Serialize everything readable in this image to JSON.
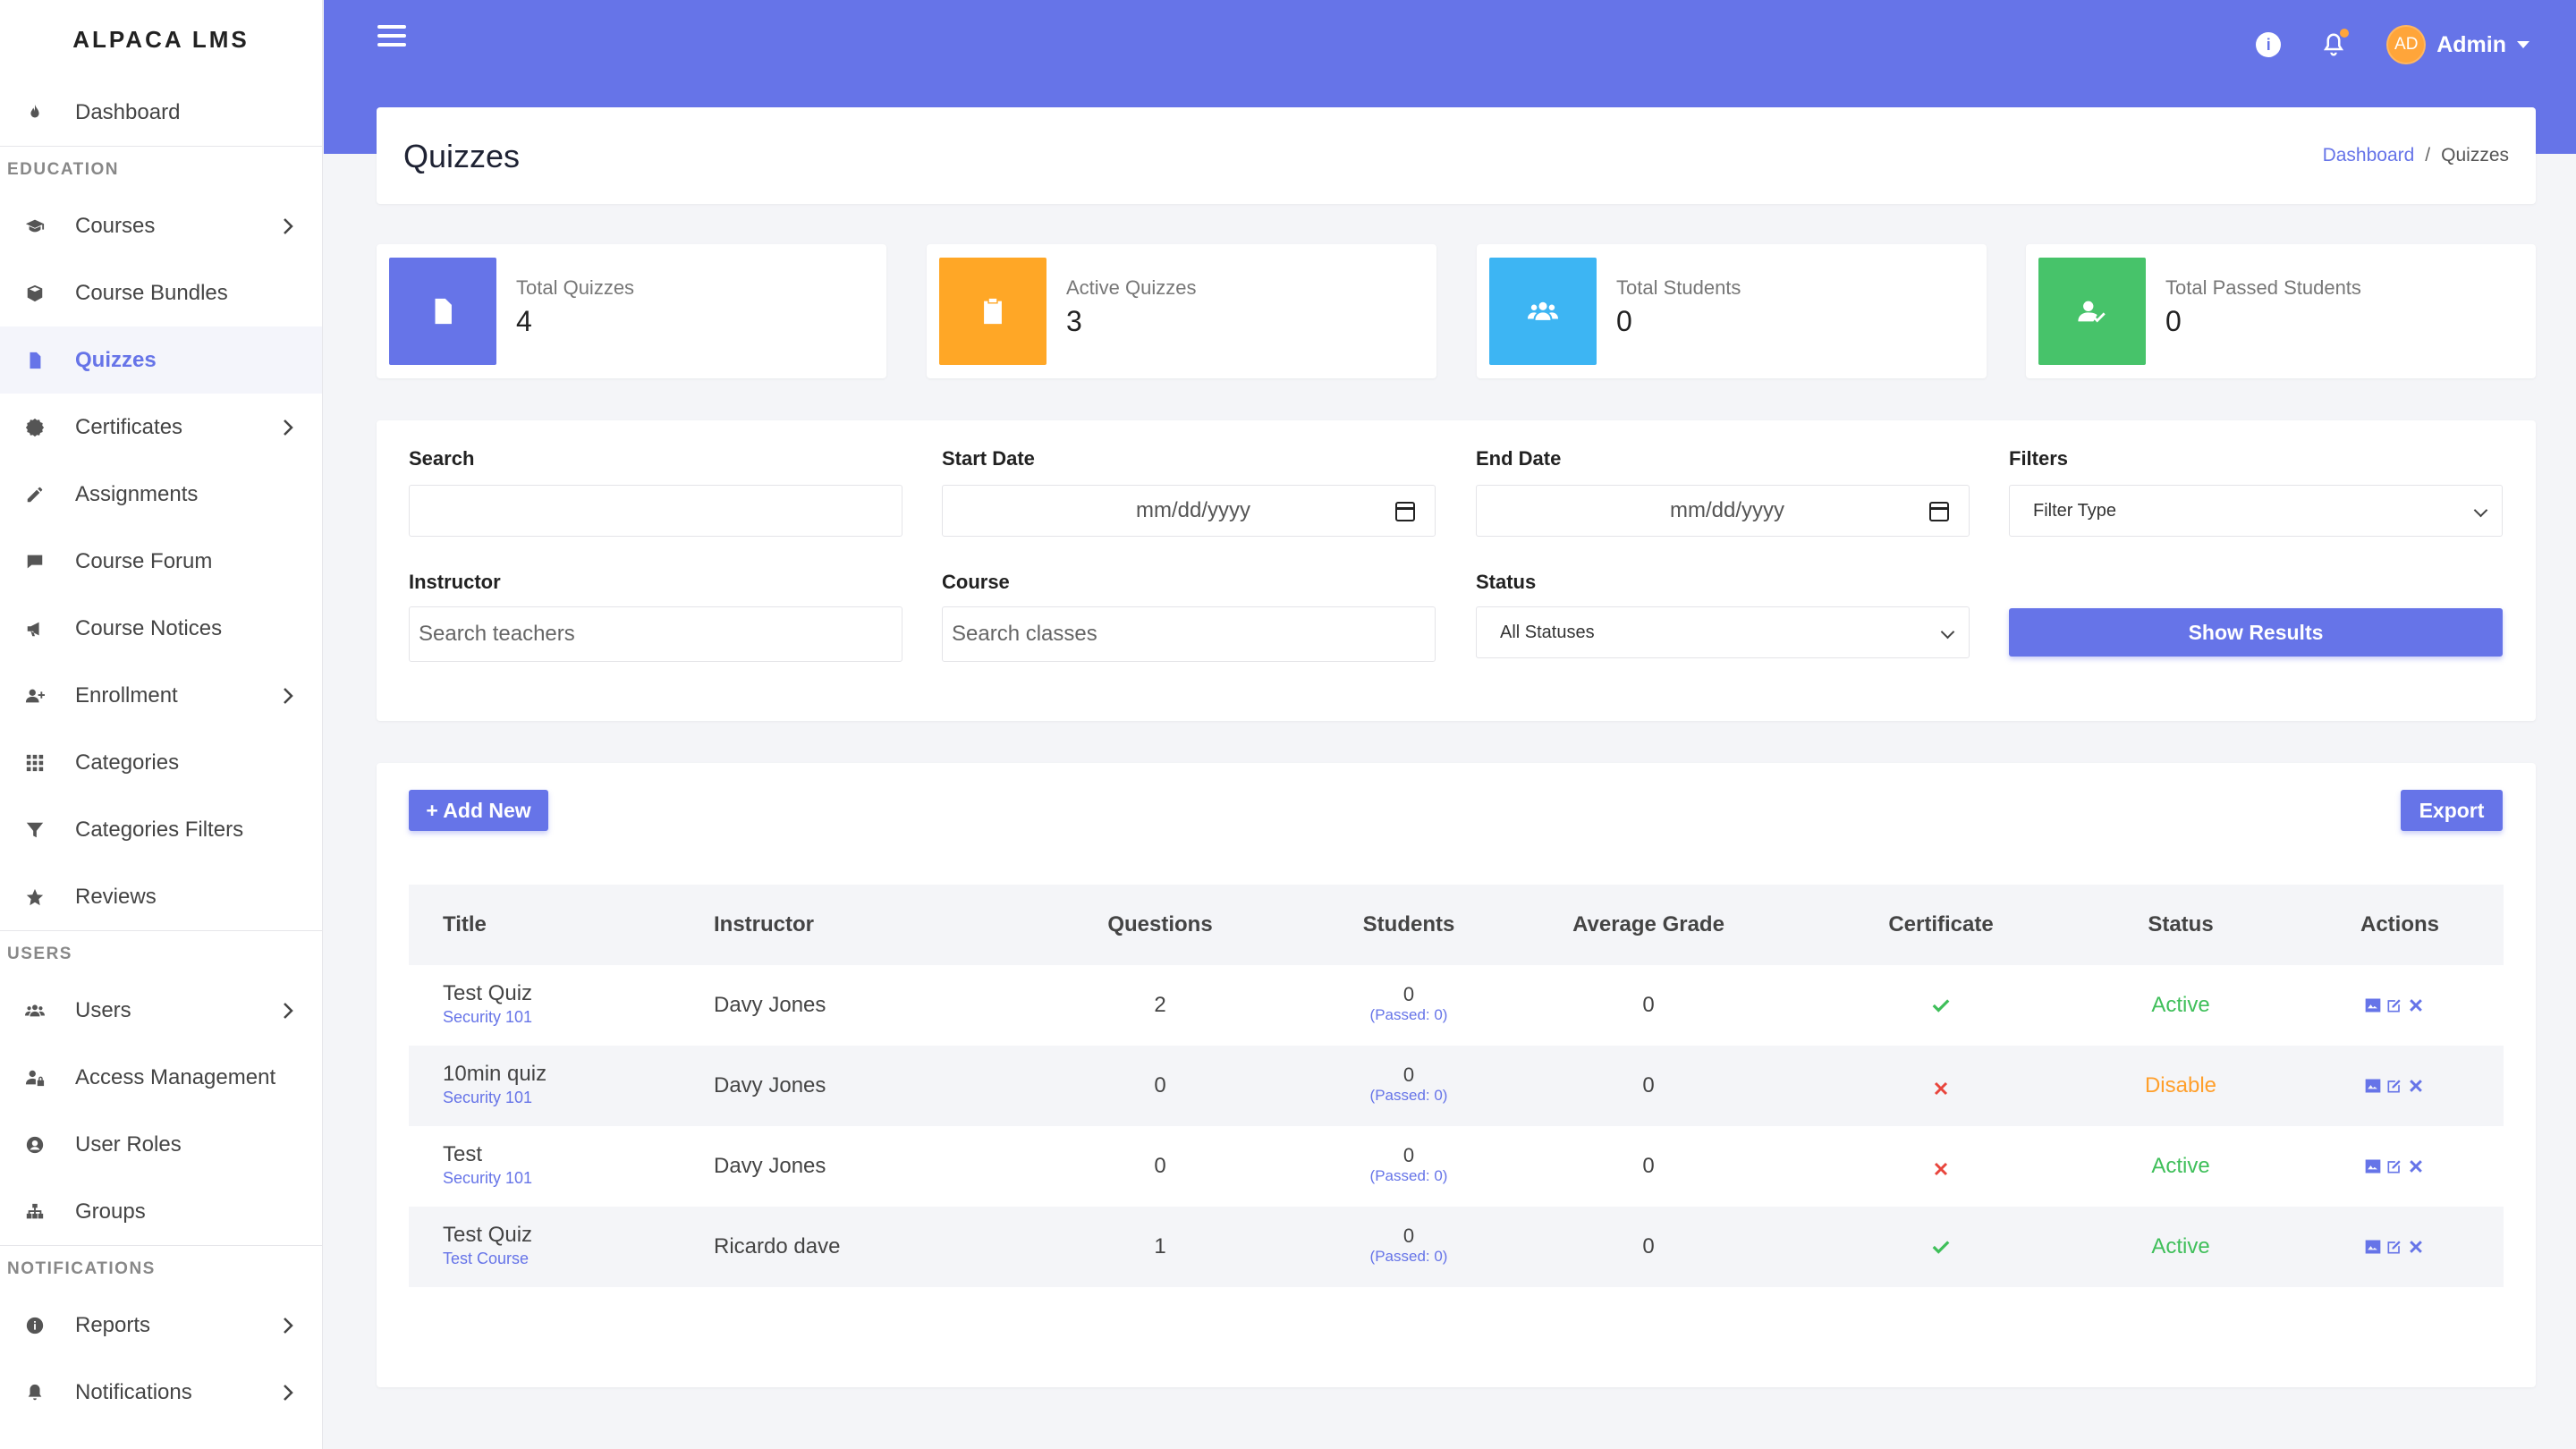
{
  "app": {
    "logo": "ALPACA LMS"
  },
  "sidebar": {
    "dashboard": "Dashboard",
    "sections": {
      "education": "EDUCATION",
      "users": "USERS",
      "notifications": "NOTIFICATIONS"
    },
    "education_items": [
      {
        "label": "Courses",
        "icon": "graduation-cap-icon",
        "chevron": true
      },
      {
        "label": "Course Bundles",
        "icon": "box-icon",
        "chevron": false
      },
      {
        "label": "Quizzes",
        "icon": "file-icon",
        "chevron": false,
        "active": true
      },
      {
        "label": "Certificates",
        "icon": "certificate-icon",
        "chevron": true
      },
      {
        "label": "Assignments",
        "icon": "pencil-icon",
        "chevron": false
      },
      {
        "label": "Course Forum",
        "icon": "comment-icon",
        "chevron": false
      },
      {
        "label": "Course Notices",
        "icon": "megaphone-icon",
        "chevron": false
      },
      {
        "label": "Enrollment",
        "icon": "user-plus-icon",
        "chevron": true
      },
      {
        "label": "Categories",
        "icon": "grid-icon",
        "chevron": false
      },
      {
        "label": "Categories Filters",
        "icon": "filter-icon",
        "chevron": false
      },
      {
        "label": "Reviews",
        "icon": "star-icon",
        "chevron": false
      }
    ],
    "users_items": [
      {
        "label": "Users",
        "icon": "users-icon",
        "chevron": true
      },
      {
        "label": "Access Management",
        "icon": "user-lock-icon",
        "chevron": false
      },
      {
        "label": "User Roles",
        "icon": "user-circle-icon",
        "chevron": false
      },
      {
        "label": "Groups",
        "icon": "sitemap-icon",
        "chevron": false
      }
    ],
    "notifications_items": [
      {
        "label": "Reports",
        "icon": "info-circle-icon",
        "chevron": true
      },
      {
        "label": "Notifications",
        "icon": "bell-icon",
        "chevron": true
      }
    ]
  },
  "topbar": {
    "avatar_initials": "AD",
    "user_name": "Admin",
    "accent": "#6674e8",
    "badge_color": "#ffa53a"
  },
  "page": {
    "title": "Quizzes",
    "breadcrumb": {
      "home": "Dashboard",
      "current": "Quizzes",
      "separator": "/"
    }
  },
  "stats": [
    {
      "label": "Total Quizzes",
      "value": "4",
      "color": "#6674e8",
      "icon": "file-icon"
    },
    {
      "label": "Active Quizzes",
      "value": "3",
      "color": "#ffa726",
      "icon": "clipboard-check-icon"
    },
    {
      "label": "Total Students",
      "value": "0",
      "color": "#3db5f3",
      "icon": "users-icon"
    },
    {
      "label": "Total Passed Students",
      "value": "0",
      "color": "#47c36a",
      "icon": "user-check-icon"
    }
  ],
  "filters": {
    "search_label": "Search",
    "start_date_label": "Start Date",
    "start_date_placeholder": "mm/dd/yyyy",
    "end_date_label": "End Date",
    "end_date_placeholder": "mm/dd/yyyy",
    "filters_label": "Filters",
    "filter_type": "Filter Type",
    "instructor_label": "Instructor",
    "instructor_placeholder": "Search teachers",
    "course_label": "Course",
    "course_placeholder": "Search classes",
    "status_label": "Status",
    "status_value": "All Statuses",
    "show_results": "Show Results"
  },
  "table": {
    "add_new": "+ Add New",
    "export": "Export",
    "headers": [
      "Title",
      "Instructor",
      "Questions",
      "Students",
      "Average Grade",
      "Certificate",
      "Status",
      "Actions"
    ],
    "rows": [
      {
        "title": "Test Quiz",
        "course": "Security 101",
        "instructor": "Davy Jones",
        "questions": "2",
        "students": "0",
        "passed": "(Passed: 0)",
        "avg": "0",
        "certificate": true,
        "status": "Active"
      },
      {
        "title": "10min quiz",
        "course": "Security 101",
        "instructor": "Davy Jones",
        "questions": "0",
        "students": "0",
        "passed": "(Passed: 0)",
        "avg": "0",
        "certificate": false,
        "status": "Disable"
      },
      {
        "title": "Test",
        "course": "Security 101",
        "instructor": "Davy Jones",
        "questions": "0",
        "students": "0",
        "passed": "(Passed: 0)",
        "avg": "0",
        "certificate": false,
        "status": "Active"
      },
      {
        "title": "Test Quiz",
        "course": "Test Course",
        "instructor": "Ricardo dave",
        "questions": "1",
        "students": "0",
        "passed": "(Passed: 0)",
        "avg": "0",
        "certificate": true,
        "status": "Active"
      }
    ]
  }
}
